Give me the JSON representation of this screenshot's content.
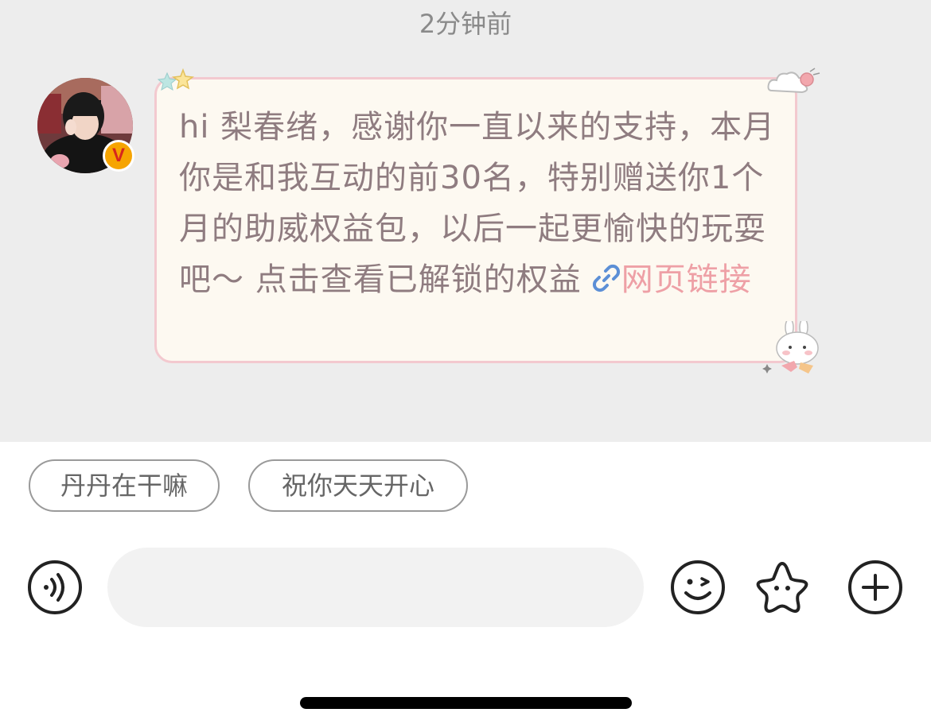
{
  "chat": {
    "timestamp": "2分钟前",
    "message": {
      "text": "hi 梨春绪，感谢你一直以来的支持，本月你是和我互动的前30名，特别赠送你1个月的助威权益包，以后一起更愉快的玩耍吧～ 点击查看已解锁的权益",
      "link_label": "网页链接",
      "link_icon": "link-icon"
    },
    "avatar": {
      "badge": "V"
    }
  },
  "quick_replies": [
    "丹丹在干嘛",
    "祝你天天开心"
  ],
  "input": {
    "placeholder": ""
  },
  "toolbar": {
    "icons": [
      "voice-icon",
      "emoji-icon",
      "sticker-star-icon",
      "add-icon"
    ]
  },
  "colors": {
    "chat_bg": "#ededed",
    "bubble_bg": "#fdf9f1",
    "bubble_border": "#f3c9cf",
    "message_text": "#8f7c80",
    "link_text": "#eea0a6"
  }
}
